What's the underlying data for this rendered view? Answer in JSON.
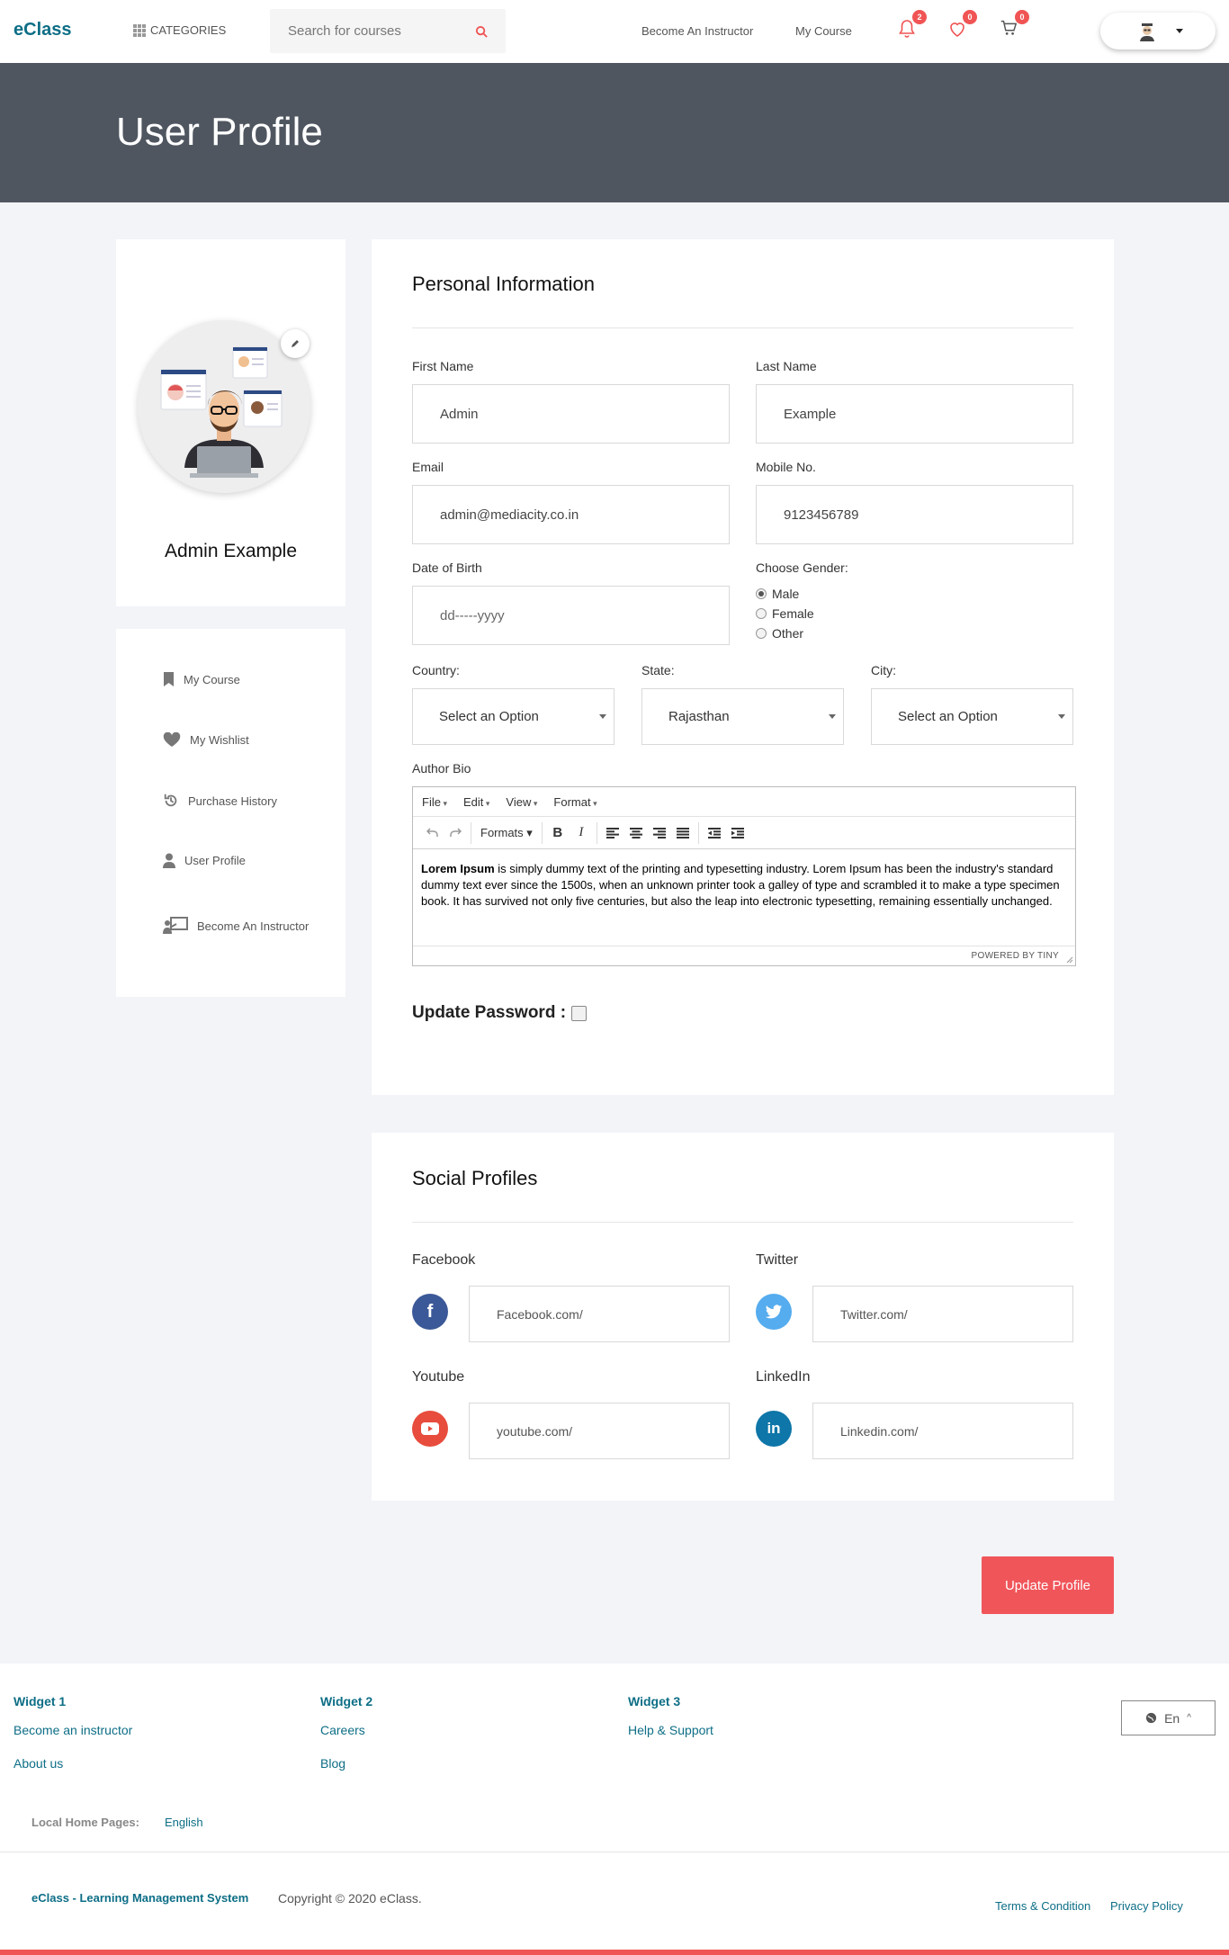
{
  "header": {
    "logo": "eClass",
    "categories_label": "CATEGORIES",
    "search_placeholder": "Search for courses",
    "become_instructor": "Become An Instructor",
    "my_course": "My Course",
    "notifications_count": "2",
    "wishlist_count": "0",
    "cart_count": "0"
  },
  "banner": {
    "title": "User Profile"
  },
  "profile": {
    "name": "Admin Example"
  },
  "sidebar": {
    "items": [
      {
        "label": "My Course",
        "icon": "bookmark-icon"
      },
      {
        "label": "My Wishlist",
        "icon": "heart-icon"
      },
      {
        "label": "Purchase History",
        "icon": "history-icon"
      },
      {
        "label": "User Profile",
        "icon": "user-icon"
      },
      {
        "label": "Become An Instructor",
        "icon": "instructor-icon"
      }
    ]
  },
  "personal": {
    "title": "Personal Information",
    "first_name_label": "First Name",
    "first_name": "Admin",
    "last_name_label": "Last Name",
    "last_name": "Example",
    "email_label": "Email",
    "email": "admin@mediacity.co.in",
    "mobile_label": "Mobile No.",
    "mobile": "9123456789",
    "dob_label": "Date of Birth",
    "dob_placeholder": "dd-----yyyy",
    "gender_label": "Choose Gender:",
    "gender_options": [
      "Male",
      "Female",
      "Other"
    ],
    "gender_selected": "Male",
    "country_label": "Country:",
    "country_value": "Select an Option",
    "state_label": "State:",
    "state_value": "Rajasthan",
    "city_label": "City:",
    "city_value": "Select an Option",
    "bio_label": "Author Bio",
    "update_password_label": "Update Password :"
  },
  "editor": {
    "menus": [
      "File",
      "Edit",
      "View",
      "Format"
    ],
    "formats_label": "Formats",
    "content_bold": "Lorem Ipsum",
    "content_rest": " is simply dummy text of the printing and typesetting industry. Lorem Ipsum has been the industry's standard dummy text ever since the 1500s, when an unknown printer took a galley of type and scrambled it to make a type specimen book. It has survived not only five centuries, but also the leap into electronic typesetting, remaining essentially unchanged.",
    "status": "POWERED BY TINY"
  },
  "social": {
    "title": "Social Profiles",
    "facebook_label": "Facebook",
    "facebook_placeholder": "Facebook.com/",
    "twitter_label": "Twitter",
    "twitter_placeholder": "Twitter.com/",
    "youtube_label": "Youtube",
    "youtube_placeholder": "youtube.com/",
    "linkedin_label": "LinkedIn",
    "linkedin_placeholder": "Linkedin.com/"
  },
  "actions": {
    "update_profile": "Update Profile"
  },
  "footer": {
    "widget1_title": "Widget 1",
    "widget1_links": [
      "Become an instructor",
      "About us"
    ],
    "widget2_title": "Widget 2",
    "widget2_links": [
      "Careers",
      "Blog"
    ],
    "widget3_title": "Widget 3",
    "widget3_links": [
      "Help & Support"
    ],
    "language": "En",
    "local_pages_label": "Local Home Pages:",
    "local_pages_value": "English",
    "brand": "eClass - Learning Management System",
    "copyright": "Copyright © 2020 eClass.",
    "terms": "Terms & Condition",
    "privacy": "Privacy Policy"
  },
  "colors": {
    "brand": "#0d6e86",
    "accent": "#f0555a",
    "banner": "#4f5660",
    "facebook": "#3b5998",
    "twitter": "#55acee",
    "youtube": "#e74c3c",
    "linkedin": "#0e76a8"
  }
}
